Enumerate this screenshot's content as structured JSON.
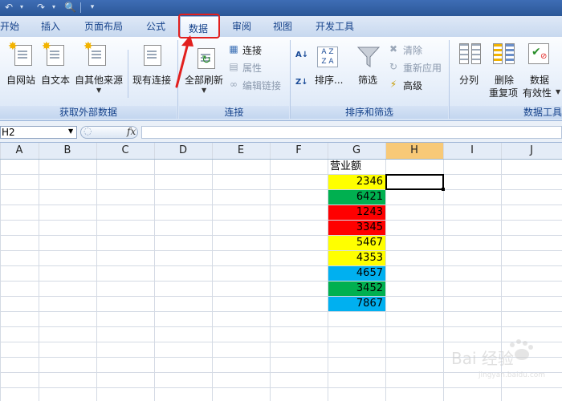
{
  "tabs": [
    "开始",
    "插入",
    "页面布局",
    "公式",
    "数据",
    "审阅",
    "视图",
    "开发工具"
  ],
  "ribbon": {
    "external": {
      "group_label": "获取外部数据",
      "from_web": "自网站",
      "from_text": "自文本",
      "from_other": "自其他来源",
      "existing": "现有连接"
    },
    "connections": {
      "group_label": "连接",
      "refresh_all": "全部刷新",
      "connections": "连接",
      "properties": "属性",
      "edit_links": "编辑链接"
    },
    "sort_filter": {
      "group_label": "排序和筛选",
      "sort": "排序...",
      "filter": "筛选",
      "clear": "清除",
      "reapply": "重新应用",
      "advanced": "高级"
    },
    "data_tools": {
      "group_label": "数据工具",
      "text_to_columns": "分列",
      "remove_dup_1": "删除",
      "remove_dup_2": "重复项",
      "validation_1": "数据",
      "validation_2": "有效性"
    }
  },
  "formula_bar": {
    "name_box": "H2",
    "fx": "fx",
    "formula": ""
  },
  "columns": [
    "A",
    "B",
    "C",
    "D",
    "E",
    "F",
    "G",
    "H",
    "I",
    "J"
  ],
  "sheet": {
    "header_cell": "营业额",
    "cells": [
      {
        "value": "2346",
        "color": "#ffff00"
      },
      {
        "value": "6421",
        "color": "#00b050"
      },
      {
        "value": "1243",
        "color": "#ff0000"
      },
      {
        "value": "3345",
        "color": "#ff0000"
      },
      {
        "value": "5467",
        "color": "#ffff00"
      },
      {
        "value": "4353",
        "color": "#ffff00"
      },
      {
        "value": "4657",
        "color": "#00b0f0"
      },
      {
        "value": "3452",
        "color": "#00b050"
      },
      {
        "value": "7867",
        "color": "#00b0f0"
      }
    ]
  },
  "colors": {
    "selected_column_header": "#f8c977",
    "highlight": "#e2201e"
  },
  "watermark": {
    "text": "Bai 经验",
    "url": "jingyan.baidu.com"
  }
}
